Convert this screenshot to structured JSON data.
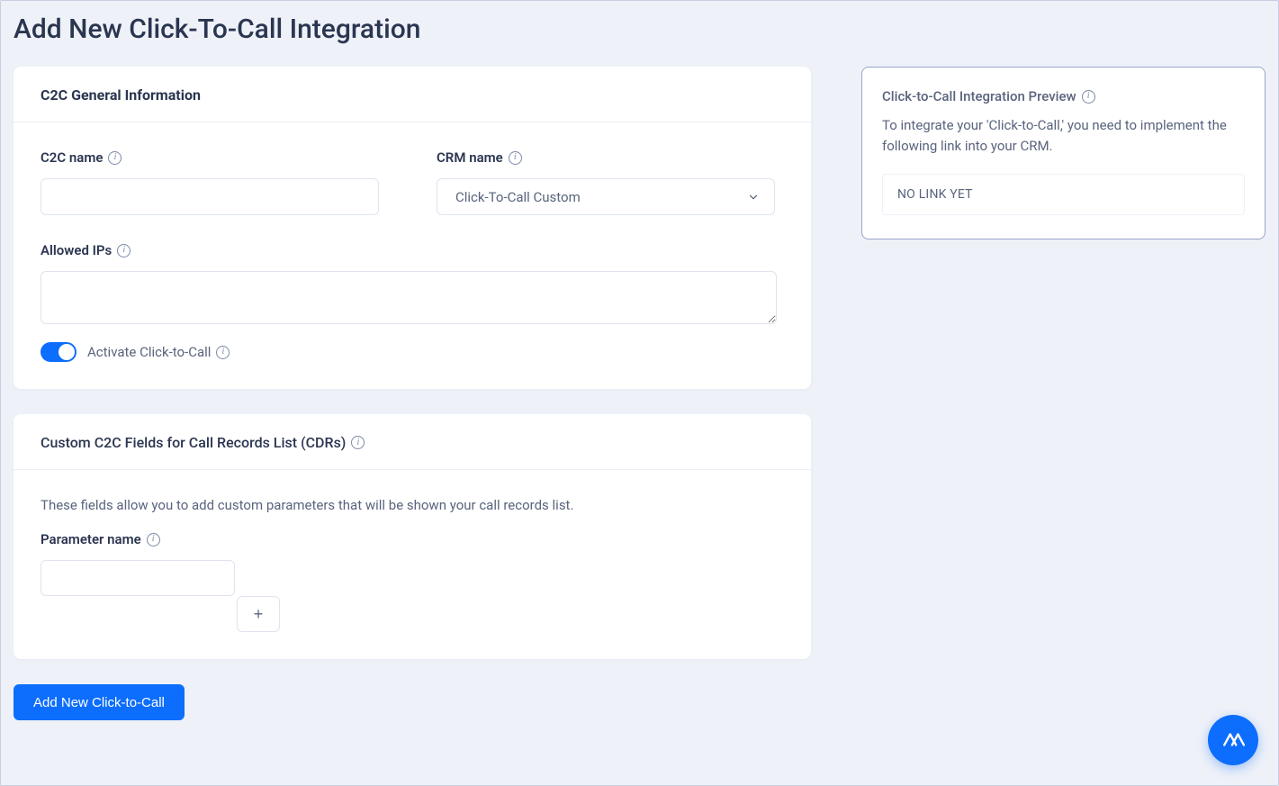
{
  "page": {
    "title": "Add New Click-To-Call Integration"
  },
  "general": {
    "card_title": "C2C General Information",
    "c2c_name": {
      "label": "C2C name",
      "value": ""
    },
    "crm_name": {
      "label": "CRM name",
      "selected": "Click-To-Call Custom"
    },
    "allowed_ips": {
      "label": "Allowed IPs",
      "value": ""
    },
    "activate_toggle": {
      "label": "Activate Click-to-Call",
      "on": true
    }
  },
  "custom_fields": {
    "card_title": "Custom C2C Fields for Call Records List (CDRs)",
    "description": "These fields allow you to add custom parameters that will be shown your call records list.",
    "param_label": "Parameter name",
    "param_value": "",
    "plus_label": "+"
  },
  "submit": {
    "label": "Add New Click-to-Call"
  },
  "preview": {
    "title": "Click-to-Call Integration Preview",
    "text": "To integrate your 'Click-to-Call,' you need to implement the following link into your CRM.",
    "link": "NO LINK YET"
  },
  "colors": {
    "accent": "#0d6efd"
  }
}
